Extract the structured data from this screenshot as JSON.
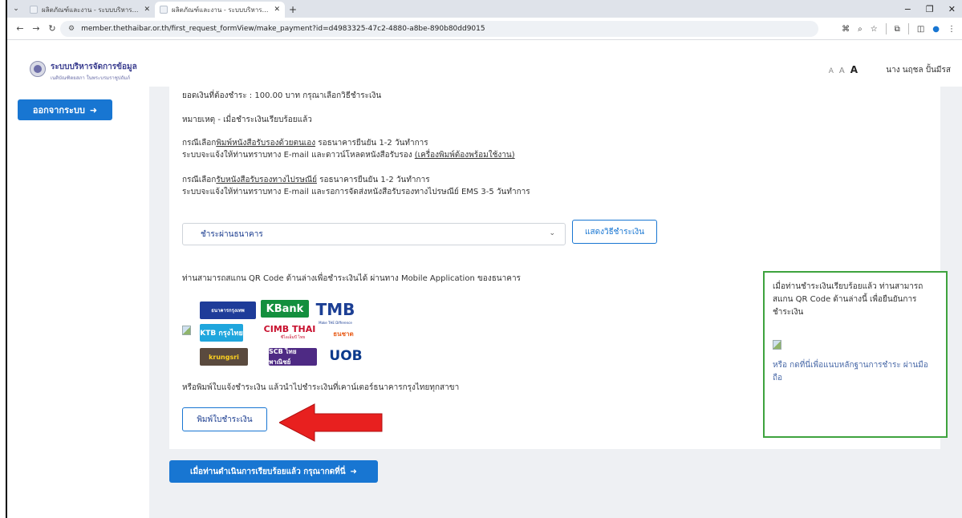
{
  "browser": {
    "tabs": [
      {
        "title": "ผลิตภัณฑ์และงาน - ระบบบริหารจัดการข้อมูล"
      },
      {
        "title": "ผลิตภัณฑ์และงาน - ระบบบริหารจัดการข้อมูล"
      }
    ],
    "url": "member.thethaibar.or.th/first_request_formView/make_payment?id=d4983325-47c2-4880-a8be-890b80dd9015"
  },
  "site": {
    "brand_line1": "ระบบบริหารจัดการข้อมูล",
    "brand_line2": "เนติบัณฑิตยสภา ในพระบรมราชูปถัมภ์",
    "font_size_small": "A",
    "font_size_medium": "A",
    "font_size_large": "A",
    "user_name": "นาง นฤชล ปั้นมีรส"
  },
  "sidebar": {
    "logout_label": "ออกจากระบบ"
  },
  "payment": {
    "amount_line": "ยอดเงินที่ต้องชำระ : 100.00 บาท กรุณาเลือกวิธีชำระเงิน",
    "note_line": "หมายเหตุ - เมื่อชำระเงินเรียบร้อยแล้ว",
    "self_print_prefix": "กรณีเลือก",
    "self_print_link": "พิมพ์หนังสือรับรองด้วยตนเอง",
    "self_print_suffix": " รอธนาคารยืนยัน 1-2 วันทำการ",
    "self_print_line2_prefix": "ระบบจะแจ้งให้ท่านทราบทาง E-mail และดาวน์โหลดหนังสือรับรอง ",
    "self_print_line2_link": "(เครื่องพิมพ์ต้องพร้อมใช้งาน)",
    "post_prefix": "กรณีเลือก",
    "post_link": "รับหนังสือรับรองทางไปรษณีย์",
    "post_suffix": " รอธนาคารยืนยัน 1-2 วันทำการ",
    "post_line2": "ระบบจะแจ้งให้ท่านทราบทาง E-mail และรอการจัดส่งหนังสือรับรองทางไปรษณีย์ EMS 3-5 วันทำการ",
    "method_selected": "ชำระผ่านธนาคาร",
    "show_method_button": "แสดงวิธีชำระเงิน",
    "qr_instruction": "ท่านสามารถสแกน QR Code ด้านล่างเพื่อชำระเงินได้ ผ่านทาง Mobile Application ของธนาคาร",
    "print_instruction": "หรือพิมพ์ใบแจ้งชำระเงิน แล้วนำไปชำระเงินที่เคาน์เตอร์ธนาคารกรุงไทยทุกสาขา",
    "print_button": "พิมพ์ใบชำระเงิน",
    "confirm_text": [
      "เมื่อท่านชำระเงินเรียบร้อยแล้ว ท่านสามารถ",
      "สแกน QR Code ด้านล่างนี้ เพื่อยืนยันการ",
      "ชำระเงิน"
    ],
    "attach_link": "หรือ กดที่นี่เพื่อแนบหลักฐานการชำระ ผ่านมือถือ",
    "done_button": "เมื่อท่านดำเนินการเรียบร้อยแล้ว กรุณากดที่นี่"
  },
  "banks": {
    "bbl": "ธนาคารกรุงเทพ",
    "kbank": "KBank",
    "tmb": "TMB",
    "tmb_tagline": "Make THE Difference",
    "ktb": "KTB กรุงไทย",
    "cimb": "CIMB THAI",
    "cimb_sub": "ซีไอเอ็มบี ไทย",
    "thanachart": "ธนชาต",
    "krungsri": "krungsri",
    "scb": "SCB ไทยพาณิชย์",
    "uob": "UOB"
  },
  "colors": {
    "primary": "#1876d2",
    "confirm_box_border": "#3ea33e",
    "annotation_arrow": "#e8201f"
  }
}
